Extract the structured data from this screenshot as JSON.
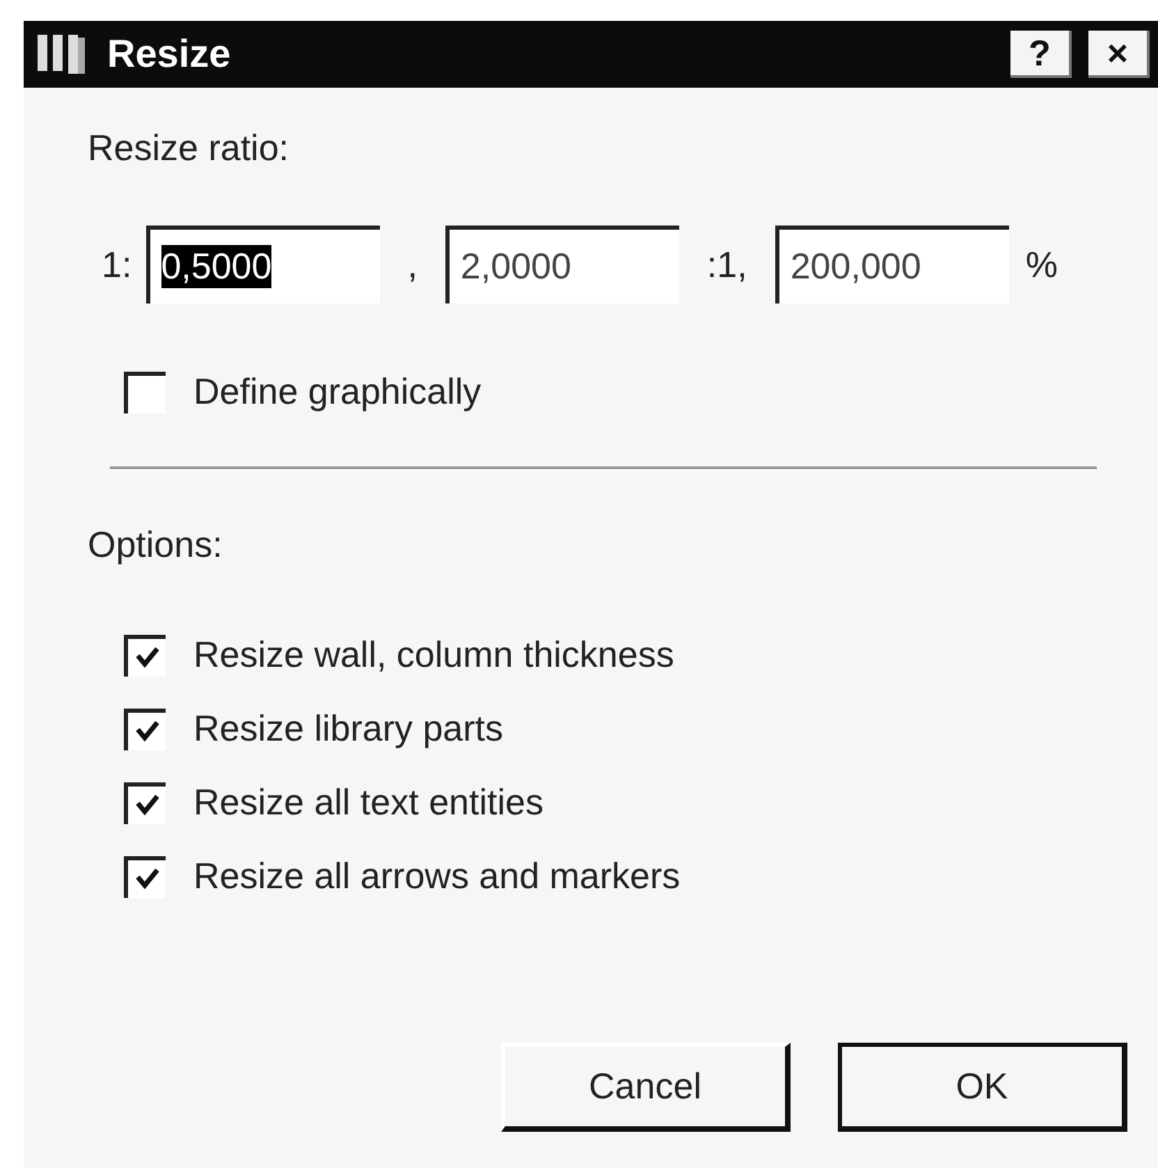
{
  "window": {
    "title": "Resize",
    "help_button": "?",
    "close_button": "×"
  },
  "ratio_label": "Resize ratio:",
  "ratio_row": [
    {
      "kind": "text",
      "text": "1:"
    },
    {
      "kind": "field",
      "value": "0,5000",
      "selected": true
    },
    {
      "kind": "text",
      "text": ","
    },
    {
      "kind": "field",
      "value": "2,0000",
      "selected": false
    },
    {
      "kind": "text",
      "text": ":1,"
    },
    {
      "kind": "field",
      "value": "200,000",
      "selected": false
    },
    {
      "kind": "text",
      "text": "%"
    }
  ],
  "define_graphically": {
    "label": "Define graphically",
    "checked": false
  },
  "options_label": "Options:",
  "options": [
    {
      "label": "Resize wall, column thickness",
      "checked": true
    },
    {
      "label": "Resize library parts",
      "checked": true
    },
    {
      "label": "Resize all text entities",
      "checked": true
    },
    {
      "label": "Resize all arrows and markers",
      "checked": true
    }
  ],
  "buttons": [
    {
      "label": "Cancel",
      "default": false
    },
    {
      "label": "OK",
      "default": true
    }
  ]
}
